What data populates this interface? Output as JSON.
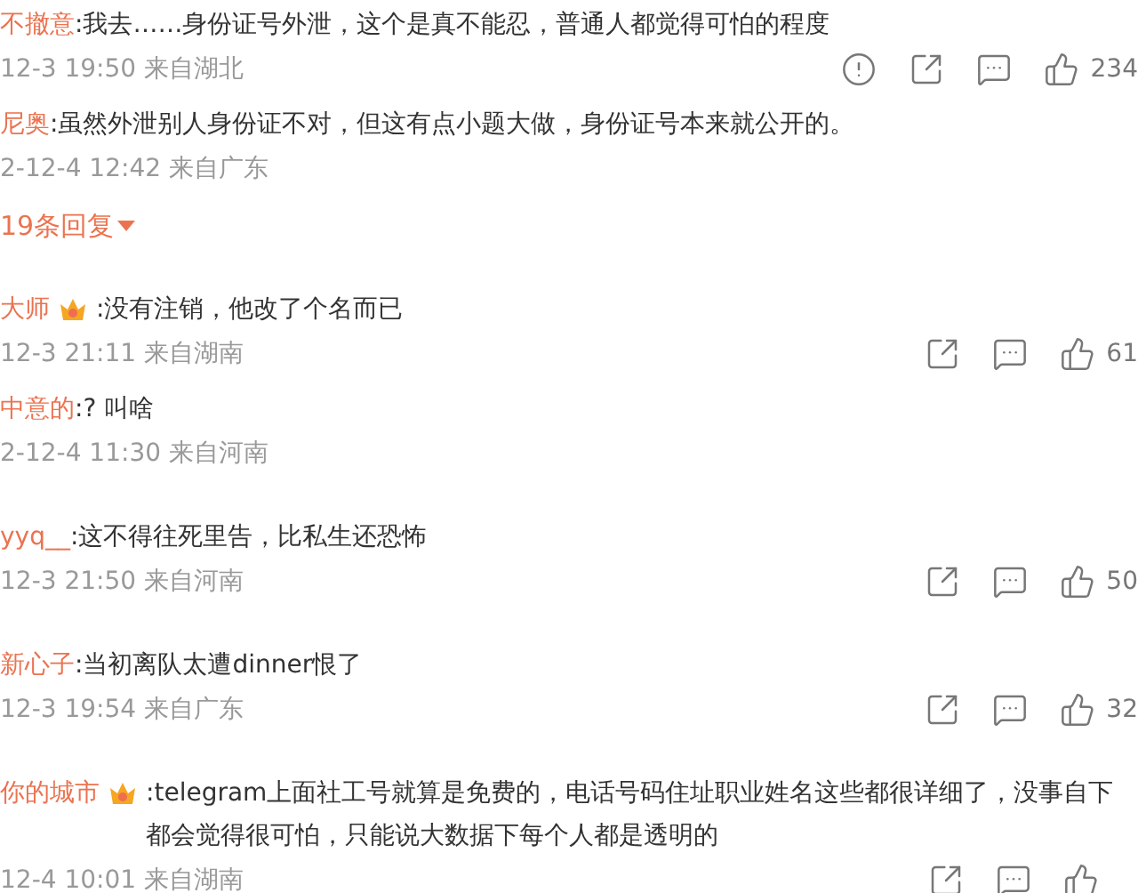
{
  "items": [
    {
      "kind": "comment",
      "name": "不撤意",
      "badge": false,
      "text": ":我去……身份证号外泄，这个是真不能忍，普通人都觉得可怕的程度",
      "meta": "12-3 19:50 来自湖北",
      "report": true,
      "likes": "234"
    },
    {
      "kind": "reply",
      "name": "尼奥",
      "badge": false,
      "text": ":虽然外泄别人身份证不对，但这有点小题大做，身份证号本来就公开的。",
      "meta": "2-12-4 12:42 来自广东"
    },
    {
      "kind": "more",
      "label": "19条回复"
    },
    {
      "kind": "comment",
      "name": "大师",
      "badge": true,
      "text": ":没有注销，他改了个名而已",
      "meta": "12-3 21:11 来自湖南",
      "report": false,
      "likes": "61"
    },
    {
      "kind": "reply",
      "name": "中意的",
      "badge": false,
      "text": ":? 叫啥",
      "meta": "2-12-4 11:30 来自河南"
    },
    {
      "kind": "comment",
      "name": "yyq__",
      "badge": false,
      "text": ":这不得往死里告，比私生还恐怖",
      "meta": "12-3 21:50 来自河南",
      "report": false,
      "likes": "50"
    },
    {
      "kind": "comment",
      "name": "新心子",
      "badge": false,
      "text": ":当初离队太遭dinner恨了",
      "meta": "12-3 19:54 来自广东",
      "report": false,
      "likes": "32"
    },
    {
      "kind": "comment",
      "name": "你的城市",
      "badge": true,
      "text": ":telegram上面社工号就算是免费的，电话号码住址职业姓名这些都很详细了，没事自下都会觉得很可怕，只能说大数据下每个人都是透明的",
      "meta": "12-4 10:01 来自湖南",
      "report": false
    }
  ]
}
